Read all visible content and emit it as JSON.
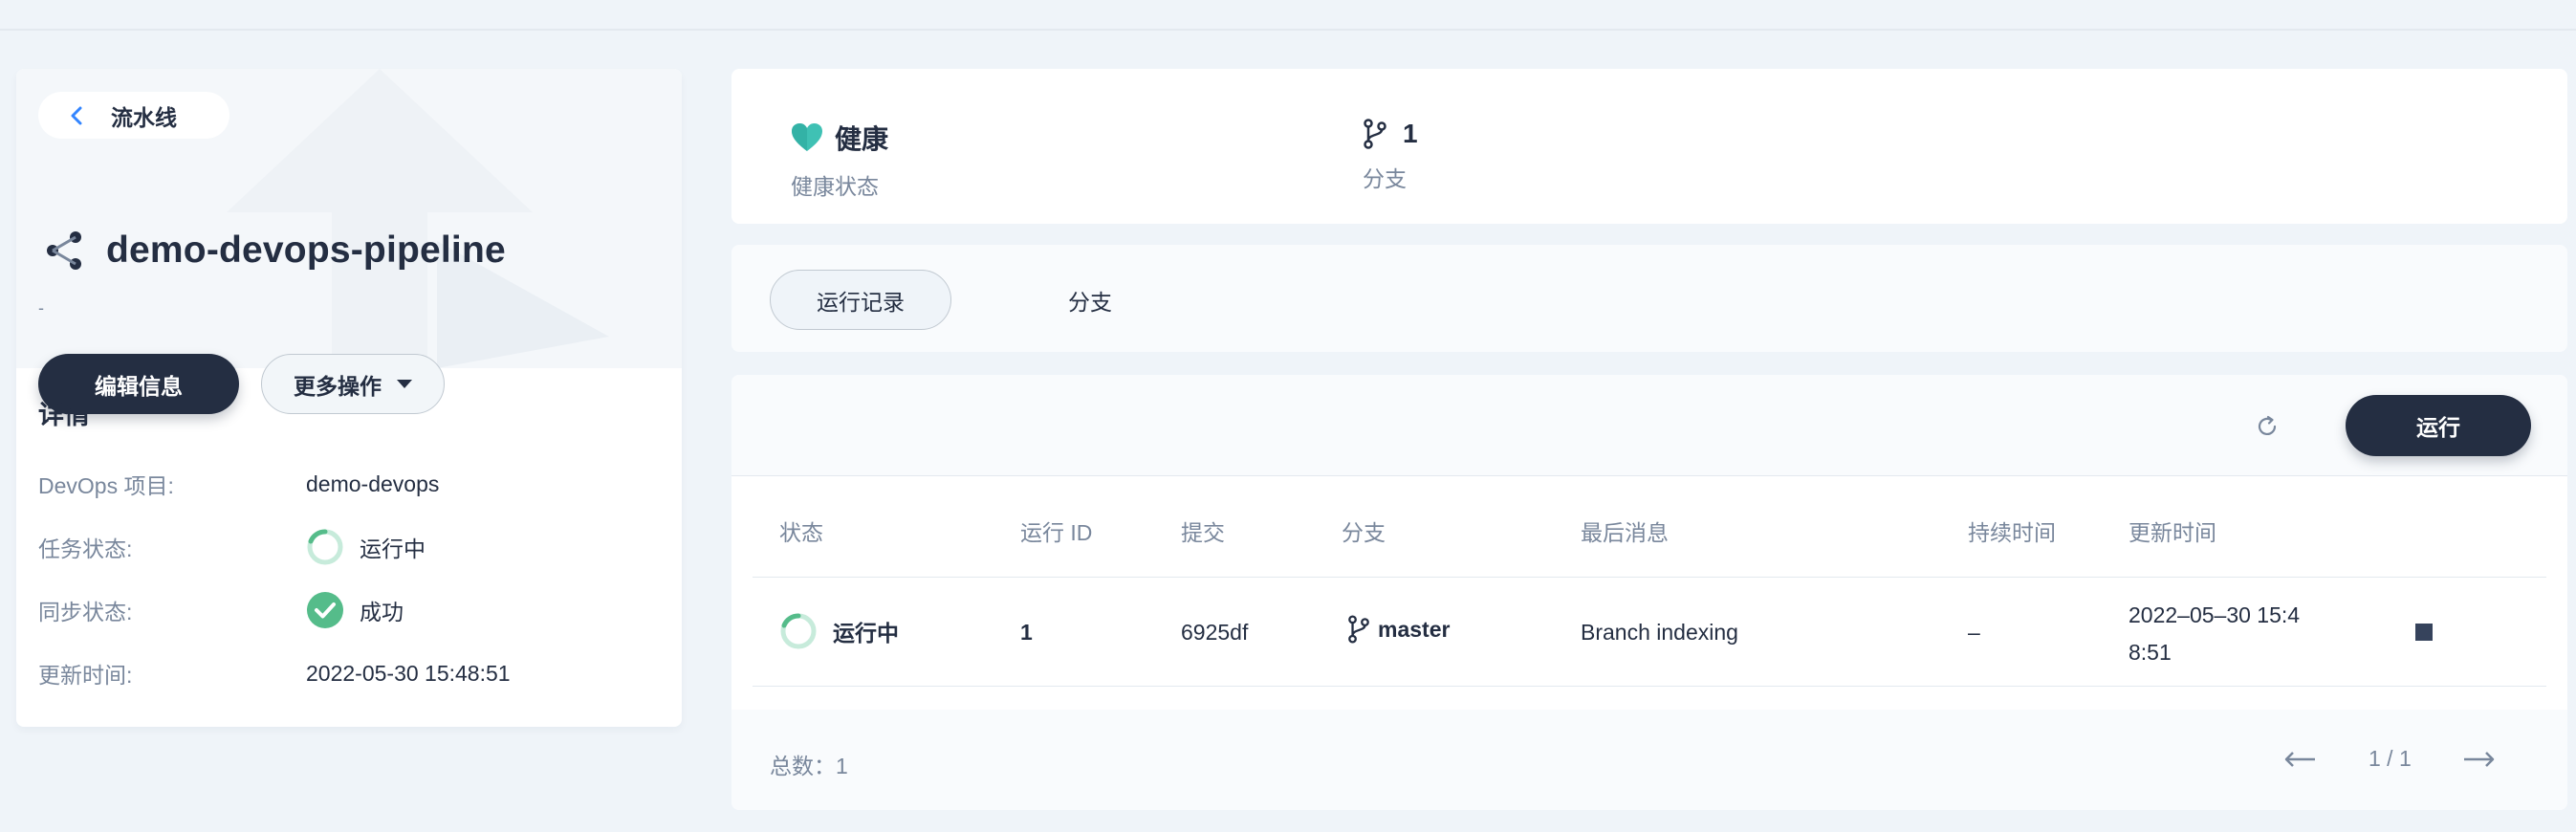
{
  "back": {
    "label": "流水线"
  },
  "pipeline": {
    "name": "demo-devops-pipeline",
    "description": "-"
  },
  "actions": {
    "edit_label": "编辑信息",
    "more_label": "更多操作"
  },
  "details": {
    "title": "详情",
    "rows": [
      {
        "key": "DevOps 项目:",
        "value": "demo-devops"
      },
      {
        "key": "任务状态:",
        "value": "运行中"
      },
      {
        "key": "同步状态:",
        "value": "成功"
      },
      {
        "key": "更新时间:",
        "value": "2022-05-30 15:48:51"
      }
    ]
  },
  "stats": {
    "health": {
      "value": "健康",
      "label": "健康状态"
    },
    "branches": {
      "value": "1",
      "label": "分支"
    }
  },
  "tabs": [
    {
      "label": "运行记录",
      "active": true
    },
    {
      "label": "分支",
      "active": false
    }
  ],
  "toolbar": {
    "run_label": "运行"
  },
  "table": {
    "headers": [
      "状态",
      "运行 ID",
      "提交",
      "分支",
      "最后消息",
      "持续时间",
      "更新时间"
    ],
    "rows": [
      {
        "status": "运行中",
        "run_id": "1",
        "commit": "6925df",
        "branch": "master",
        "message": "Branch indexing",
        "duration": "–",
        "updated_line1": "2022–05–30 15:4",
        "updated_line2": "8:51"
      }
    ]
  },
  "footer": {
    "total": "总数：1",
    "pagination": "1 / 1"
  },
  "colors": {
    "dark": "#242e42",
    "muted": "#79879c",
    "success": "#55bc8a",
    "health": "#3fc1b4",
    "background": "#eff4f9"
  }
}
